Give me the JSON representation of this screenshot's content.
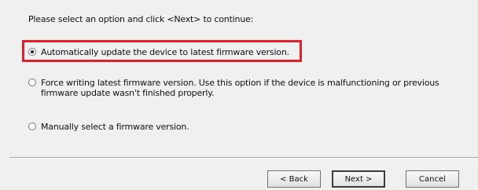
{
  "dialog": {
    "instruction": "Please select an option and click <Next> to continue:",
    "options": [
      {
        "label": "Automatically update the device to latest firmware version.",
        "selected": true
      },
      {
        "label": "Force writing latest firmware version. Use this option if the device is malfunctioning or previous firmware update wasn't finished properly.",
        "selected": false
      },
      {
        "label": "Manually select a firmware version.",
        "selected": false
      }
    ],
    "highlight_color": "#e0202a"
  },
  "buttons": {
    "back": "< Back",
    "next": "Next >",
    "cancel": "Cancel"
  }
}
